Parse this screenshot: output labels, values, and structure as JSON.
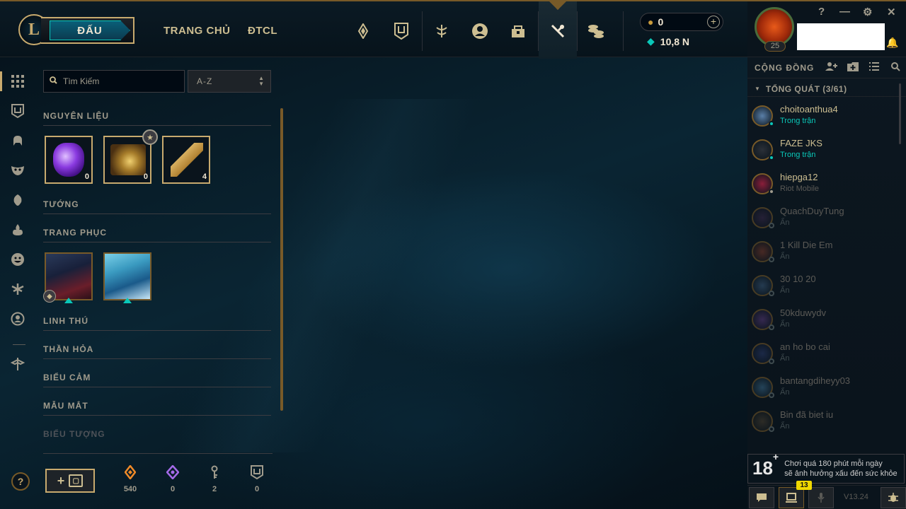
{
  "nav": {
    "logo": "L",
    "play_label": "ĐẤU",
    "links": [
      "TRANG CHỦ",
      "ĐTCL"
    ],
    "icons": [
      "tft-icon",
      "collection-icon",
      "clash-icon",
      "profile-icon",
      "loot-icon",
      "crafting-icon",
      "store-icon"
    ],
    "active_icon": "crafting-icon"
  },
  "currency": {
    "rp": "0",
    "blue_essence": "10,8 N"
  },
  "profile": {
    "level": "25",
    "help": "?",
    "minimize": "—",
    "settings": "⚙",
    "close": "✕"
  },
  "collection": {
    "search_placeholder": "Tìm Kiếm",
    "sort_value": "A-Z",
    "sections": [
      "NGUYÊN LIỆU",
      "TƯỚNG",
      "TRANG PHỤC",
      "LINH THÚ",
      "THẦN HỎA",
      "BIỂU CẢM",
      "MẪU MẮT",
      "BIỂU TƯỢNG"
    ],
    "materials": [
      {
        "name": "essence-icon",
        "count": "0"
      },
      {
        "name": "chest-icon",
        "count": "0"
      },
      {
        "name": "key-icon",
        "count": "4"
      }
    ]
  },
  "resources": [
    {
      "icon": "orange-essence-icon",
      "value": "540",
      "color": "#f08a28"
    },
    {
      "icon": "mythic-essence-icon",
      "value": "0",
      "color": "#a46ae8"
    },
    {
      "icon": "key-fragment-icon",
      "value": "2",
      "color": "#a09b8c"
    },
    {
      "icon": "chest-icon",
      "value": "0",
      "color": "#a09b8c"
    }
  ],
  "social": {
    "title": "CỘNG ĐỒNG",
    "group": "TỔNG QUÁT (3/61)",
    "friends": [
      {
        "name": "choitoanthua4",
        "status": "Trong trận",
        "state": "ingame"
      },
      {
        "name": "FAZE JKS",
        "status": "Trong trận",
        "state": "ingame"
      },
      {
        "name": "hiepga12",
        "status": "Riot Mobile",
        "state": "mobile"
      },
      {
        "name": "QuachDuyTung",
        "status": "Ẩn",
        "state": "offline"
      },
      {
        "name": "1 Kill Die Em",
        "status": "Ẩn",
        "state": "offline"
      },
      {
        "name": "30 10 20",
        "status": "Ẩn",
        "state": "offline"
      },
      {
        "name": "50kduwydv",
        "status": "Ẩn",
        "state": "offline"
      },
      {
        "name": "an ho bo cai",
        "status": "Ẩn",
        "state": "offline"
      },
      {
        "name": "bantangdiheyy03",
        "status": "Ẩn",
        "state": "offline"
      },
      {
        "name": "Bin đã biet iu",
        "status": "Ẩn",
        "state": "offline"
      }
    ],
    "notice_age": "18",
    "notice_line1": "Chơi quá 180 phút mỗi ngày",
    "notice_line2": "sẽ ảnh hưởng xấu đến sức khỏe",
    "missions_badge": "13",
    "version": "V13.24"
  },
  "colors": {
    "gold": "#c8aa6e",
    "teal": "#0ac8b9",
    "ingame": "#0ac8b9",
    "mobile": "#a09b8c"
  }
}
